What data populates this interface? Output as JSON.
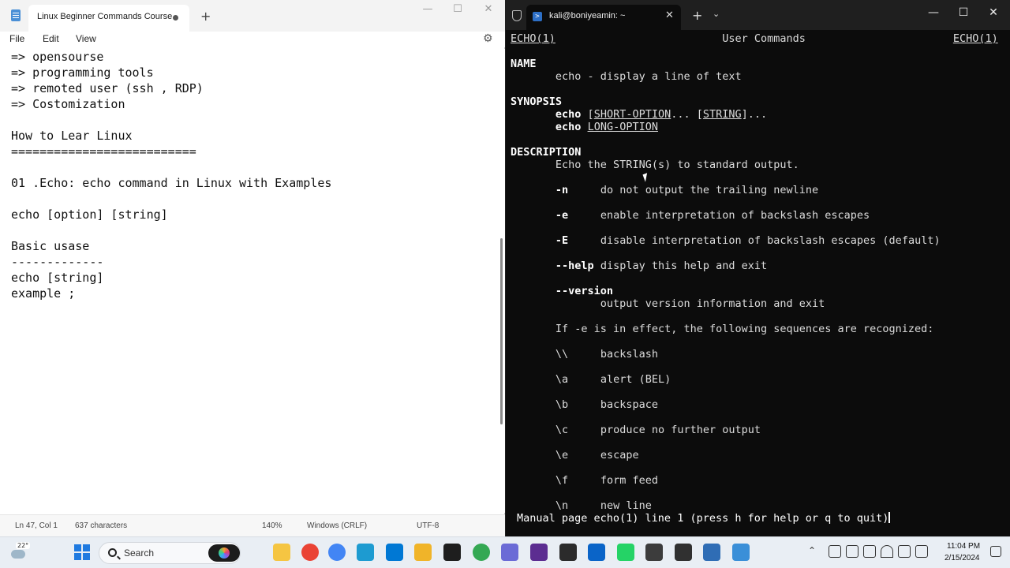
{
  "notepad": {
    "tab_title": "Linux Beginner Commands  Course",
    "new_tab": "+",
    "window_controls": {
      "minimize": "—",
      "maximize": "☐",
      "close": "✕"
    },
    "menu": {
      "file": "File",
      "edit": "Edit",
      "view": "View"
    },
    "settings_icon": "⚙",
    "lines": [
      "=> opensourse",
      "=> programming tools",
      "=> remoted user (ssh , RDP)",
      "=> Costomization",
      "",
      "How to Lear Linux",
      "==========================",
      "",
      "01 .Echo: echo command in Linux with Examples",
      "",
      "echo [option] [string]",
      "",
      "Basic usase",
      "-------------",
      "echo [string]",
      "example ;"
    ],
    "status": {
      "position": "Ln 47, Col 1",
      "characters": "637 characters",
      "zoom": "140%",
      "line_endings": "Windows (CRLF)",
      "encoding": "UTF-8"
    }
  },
  "terminal": {
    "tab_title": "kali@boniyeamin: ~",
    "tab_close": "✕",
    "new_tab": "+",
    "dropdown": "⌄",
    "window_controls": {
      "minimize": "—",
      "maximize": "☐",
      "close": "✕"
    },
    "man_header": {
      "left": "ECHO(1)",
      "center": "User Commands",
      "right": "ECHO(1)"
    },
    "name_heading": "NAME",
    "name_text": "echo - display a line of text",
    "synopsis_heading": "SYNOPSIS",
    "synopsis": [
      {
        "cmd": "echo",
        "args": [
          {
            "text": "SHORT-OPTION",
            "u": true
          },
          {
            "text": "... [",
            "u": false
          },
          {
            "text": "STRING",
            "u": true
          },
          {
            "text": "]...",
            "u": false
          }
        ],
        "open": "[",
        "close": "]"
      },
      {
        "cmd": "echo",
        "args": [
          {
            "text": "LONG-OPTION",
            "u": true
          }
        ]
      }
    ],
    "description_heading": "DESCRIPTION",
    "description_text": "Echo the STRING(s) to standard output.",
    "options": [
      {
        "flag": "-n",
        "text": "do not output the trailing newline"
      },
      {
        "flag": "-e",
        "text": "enable interpretation of backslash escapes"
      },
      {
        "flag": "-E",
        "text": "disable interpretation of backslash escapes (default)"
      },
      {
        "flag": "--help",
        "text": "display this help and exit"
      }
    ],
    "version_flag": "--version",
    "version_text": "output version information and exit",
    "sequences_intro": "If -e is in effect, the following sequences are recognized:",
    "sequences": [
      {
        "seq": "\\\\",
        "text": "backslash"
      },
      {
        "seq": "\\a",
        "text": "alert (BEL)"
      },
      {
        "seq": "\\b",
        "text": "backspace"
      },
      {
        "seq": "\\c",
        "text": "produce no further output"
      },
      {
        "seq": "\\e",
        "text": "escape"
      },
      {
        "seq": "\\f",
        "text": "form feed"
      },
      {
        "seq": "\\n",
        "text": "new line"
      }
    ],
    "pager_prompt": "Manual page echo(1) line 1 (press h for help or q to quit)"
  },
  "taskbar": {
    "weather_temp": "22°",
    "search_label": "Search",
    "apps": [
      "file-explorer-icon",
      "chrome-icon",
      "chrome-profile-icon",
      "edge-icon",
      "mail-icon",
      "folder-icon",
      "terminal-icon",
      "chrome-profile2-icon",
      "calendar-icon",
      "vs-icon",
      "cmd-icon",
      "outlook-icon",
      "whatsapp-icon",
      "gaming-icon",
      "obs-icon",
      "virtualbox-icon",
      "notepad-icon"
    ],
    "clock_time": "11:04 PM",
    "clock_date": "2/15/2024"
  }
}
